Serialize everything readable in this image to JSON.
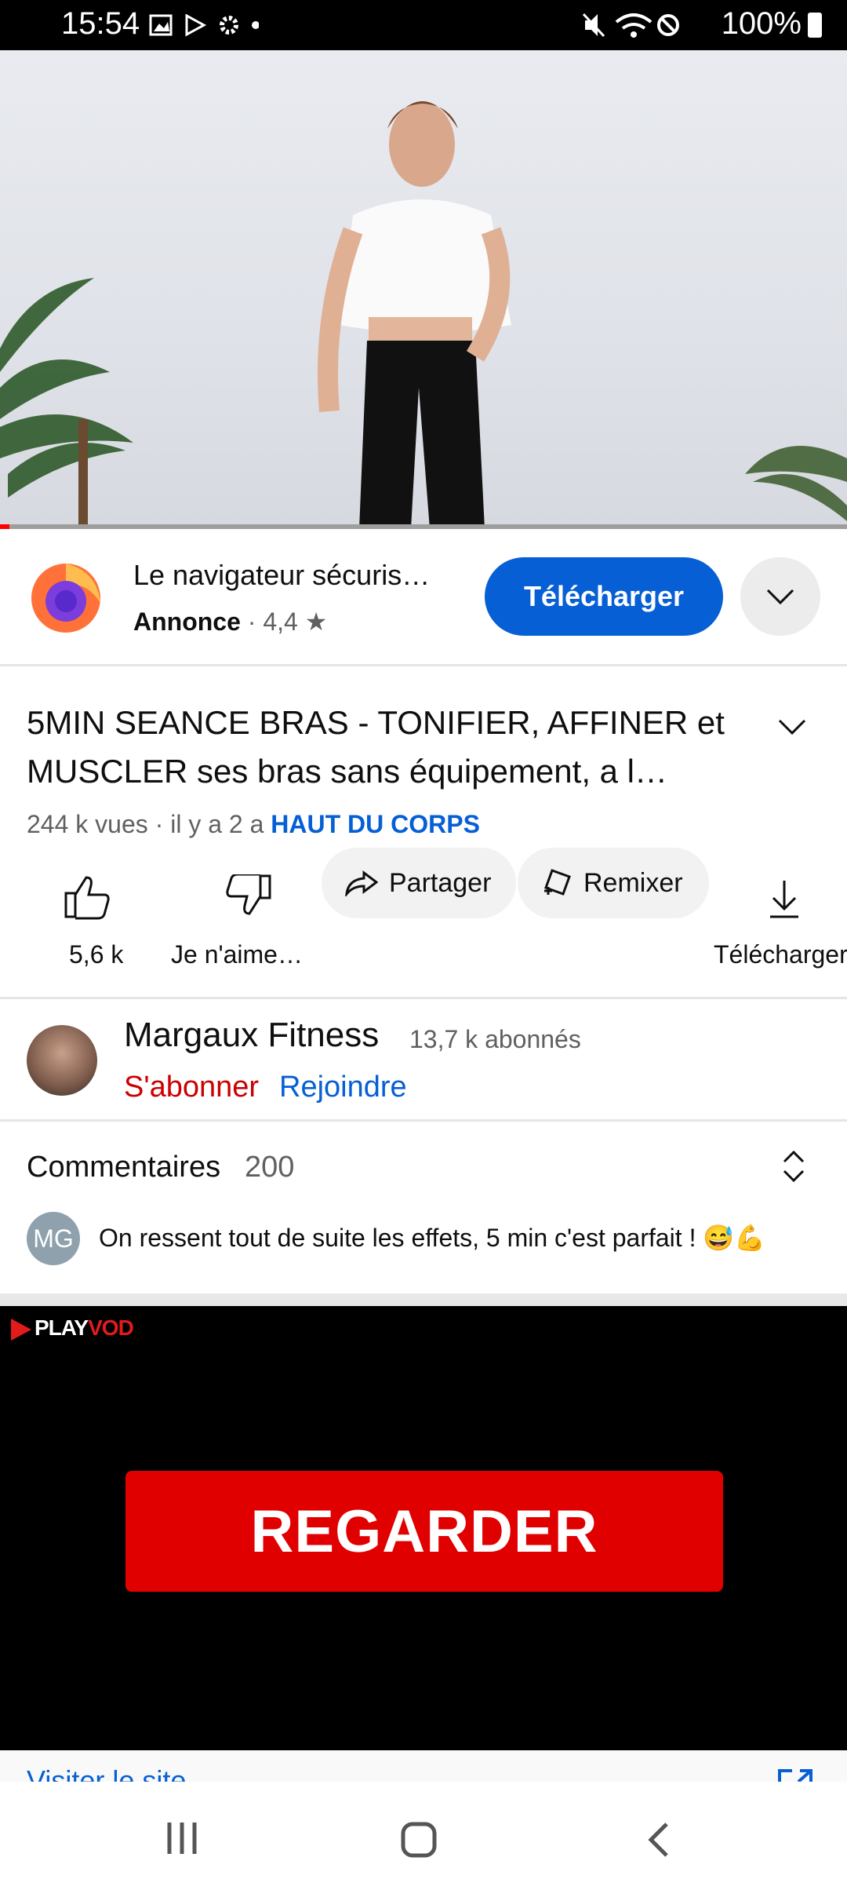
{
  "status_bar": {
    "time": "15:54",
    "battery": "100%"
  },
  "ad": {
    "title": "Le navigateur sécuris…",
    "sponsor_label": "Annonce",
    "rating": "4,4",
    "cta": "Télécharger"
  },
  "video": {
    "title": "5MIN SEANCE BRAS - TONIFIER, AFFINER et MUSCLER ses bras sans équipement, a l…",
    "views_time": "244 k vues · il y a 2 a",
    "tag": "HAUT DU CORPS",
    "progress": 0.011
  },
  "actions": {
    "likes": "5,6 k",
    "dislike_label": "Je n'aime…",
    "share": "Partager",
    "remix": "Remixer",
    "download": "Télécharger"
  },
  "channel": {
    "name": "Margaux Fitness",
    "subscribers": "13,7 k abonnés",
    "subscribe": "S'abonner",
    "join": "Rejoindre"
  },
  "comments": {
    "label": "Commentaires",
    "count": "200",
    "avatar_initials": "MG",
    "top_comment": "On ressent tout de suite les effets, 5 min c'est parfait ! 😅💪"
  },
  "bottom_ad": {
    "brand_a": "PLAY",
    "brand_b": "VOD",
    "cta": "REGARDER",
    "visit": "Visiter le site"
  },
  "colors": {
    "accent": "#065fd4",
    "subscribe": "#cc0000",
    "ad_cta": "#e10000"
  }
}
